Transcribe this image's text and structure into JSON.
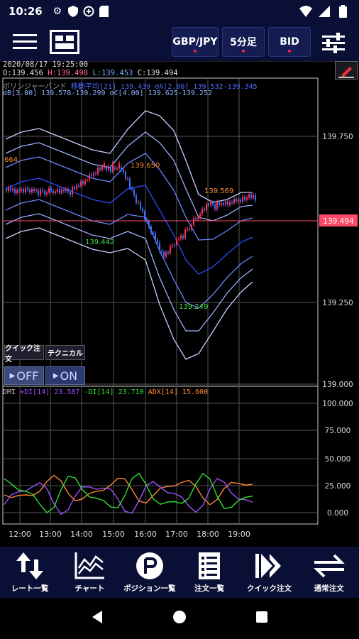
{
  "status_bar": {
    "time": "10:26"
  },
  "toolbar": {
    "currency_pair": "GBP/JPY",
    "timeframe": "5分足",
    "price_type": "BID"
  },
  "chart": {
    "info_date": "2020/08/17  19:25:00",
    "ohlc": {
      "o": "O:139.456",
      "h": "H:139.498",
      "l": "L:139.453",
      "c": "C:139.494"
    },
    "bb_line1": "ボリンジャーバンド",
    "bb_line1b": "移動平均[21] 139.439 σA[2.00] 139.532-139.345",
    "bb_line2": "σB[3.00] 139.578-139.299 σC[4.00] 139.625-139.252",
    "price_axis": [
      "139.750",
      "139.494",
      "139.250",
      "139.000"
    ],
    "current_price": "139.494",
    "annotations": {
      "left_high": "664",
      "high1": "139.650",
      "high2": "139.569",
      "low1": "139.442",
      "low2": "139.249"
    },
    "quick_order_label": "クイック注文",
    "quick_order_state": "OFF",
    "technical_label": "テクニカル",
    "technical_state": "ON",
    "dmi_legend": {
      "name": "DMI",
      "plus": "+DI[14] 23.587",
      "minus": "-DI[14] 23.710",
      "adx": "ADX[14] 15.600"
    },
    "dmi_axis": [
      "100.000",
      "75.000",
      "50.000",
      "25.000",
      "0.000"
    ],
    "time_axis": [
      "12:00",
      "13:00",
      "14:00",
      "15:00",
      "16:00",
      "17:00",
      "18:00",
      "19:00"
    ]
  },
  "bottom_nav": [
    {
      "label": "レート一覧",
      "icon": "rate-list-icon"
    },
    {
      "label": "チャート",
      "icon": "chart-icon"
    },
    {
      "label": "ポジション一覧",
      "icon": "position-icon"
    },
    {
      "label": "注文一覧",
      "icon": "order-list-icon"
    },
    {
      "label": "クイック注文",
      "icon": "quick-order-icon"
    },
    {
      "label": "通常注文",
      "icon": "normal-order-icon"
    }
  ]
}
